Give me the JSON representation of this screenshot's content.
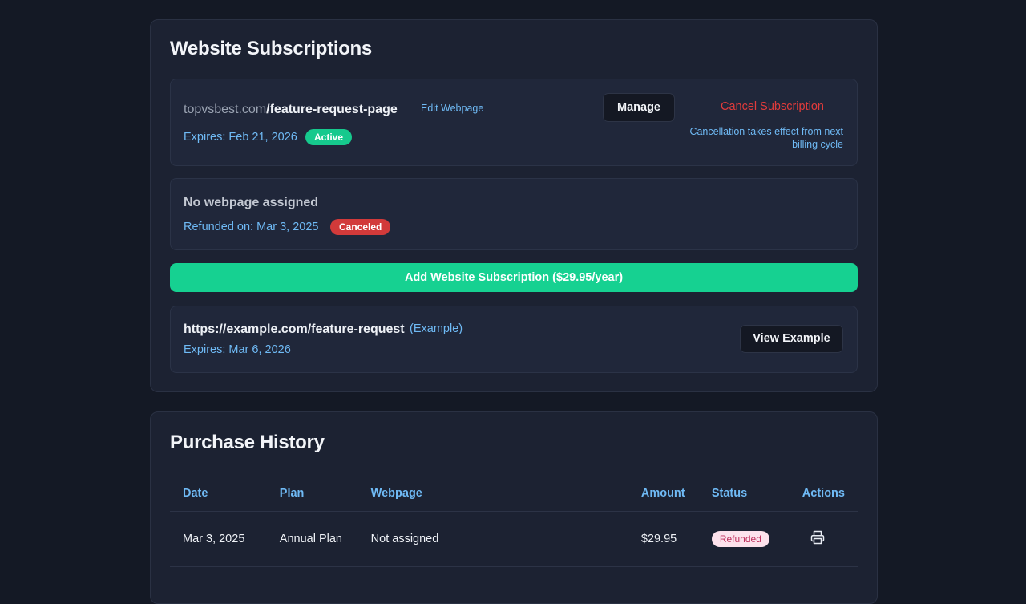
{
  "website_subscriptions": {
    "title": "Website Subscriptions",
    "items": [
      {
        "domain": "topvsbest.com",
        "path": "/feature-request-page",
        "edit_label": "Edit Webpage",
        "expires": "Expires: Feb 21, 2026",
        "status": "Active",
        "manage_label": "Manage",
        "cancel_label": "Cancel Subscription",
        "note": "Cancellation takes effect from next billing cycle"
      },
      {
        "heading": "No webpage assigned",
        "refunded": "Refunded on: Mar 3, 2025",
        "status": "Canceled"
      }
    ],
    "add_button": "Add Website Subscription ($29.95/year)",
    "example": {
      "url": "https://example.com/feature-request",
      "tag": "(Example)",
      "expires": "Expires: Mar 6, 2026",
      "view_label": "View Example"
    }
  },
  "purchase_history": {
    "title": "Purchase History",
    "columns": [
      "Date",
      "Plan",
      "Webpage",
      "Amount",
      "Status",
      "Actions"
    ],
    "rows": [
      {
        "date": "Mar 3, 2025",
        "plan": "Annual Plan",
        "webpage": "Not assigned",
        "amount": "$29.95",
        "status": "Refunded",
        "action_icon": "printer-icon"
      }
    ]
  },
  "colors": {
    "background": "#141925",
    "card": "#1c2232",
    "accent_green": "#16d191",
    "link_blue": "#6fbaf5",
    "danger_red": "#e23b3b"
  }
}
